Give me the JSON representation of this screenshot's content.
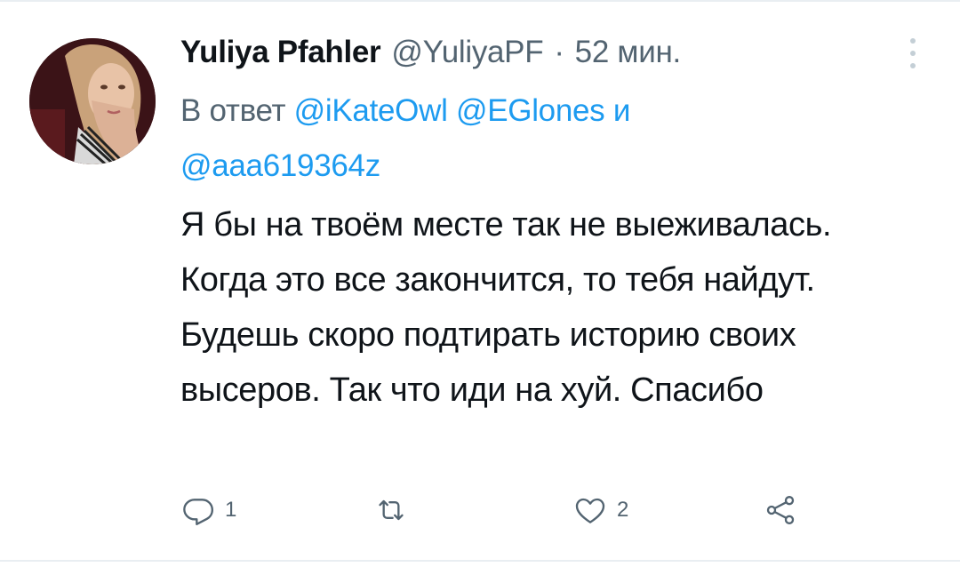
{
  "tweet": {
    "display_name": "Yuliya Pfahler",
    "handle": "@YuliyaPF",
    "separator": "·",
    "time": "52 мин.",
    "reply_prefix": "В ответ",
    "mentions": [
      "@iKateOwl",
      "@EGlones",
      "@aaa619364z"
    ],
    "mention_joiner": "и",
    "text": "Я бы на твоём месте так не выеживалась. Когда это все закончится, то тебя найдут. Будешь скоро подтирать историю своих высеров. Так что иди на хуй. Спасибо"
  },
  "actions": {
    "reply_count": "1",
    "like_count": "2"
  },
  "icons": {
    "more": "more-vertical-icon",
    "reply": "reply-icon",
    "retweet": "retweet-icon",
    "like": "heart-icon",
    "share": "share-icon"
  },
  "colors": {
    "text_primary": "#0f1419",
    "text_secondary": "#536471",
    "link": "#1d9bf0",
    "divider": "#e9eef2"
  }
}
